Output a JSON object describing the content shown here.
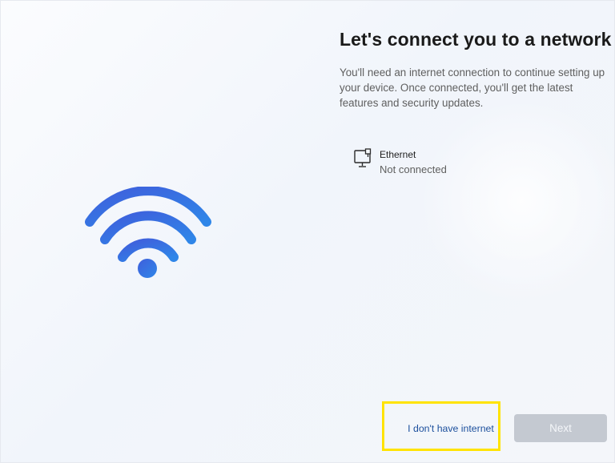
{
  "page": {
    "title": "Let's connect you to a network",
    "description": "You'll need an internet connection to continue setting up your device. Once connected, you'll get the latest features and security updates."
  },
  "network": {
    "name": "Ethernet",
    "status": "Not connected",
    "icon": "ethernet-monitor-icon"
  },
  "illustration": {
    "icon": "wifi-icon",
    "colors": {
      "start": "#3f5fdc",
      "end": "#2f86e8"
    }
  },
  "actions": {
    "no_internet_label": "I don't have internet",
    "next_label": "Next",
    "next_disabled": true,
    "highlight_color": "#ffe300"
  }
}
